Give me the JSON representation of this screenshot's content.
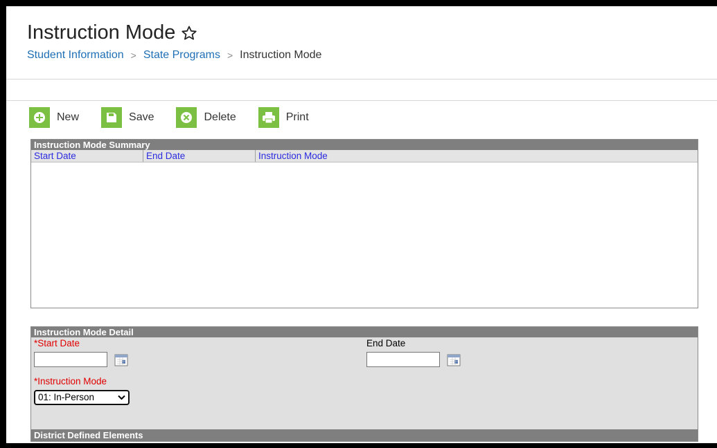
{
  "header": {
    "title": "Instruction Mode",
    "breadcrumb": {
      "items": [
        "Student Information",
        "State Programs"
      ],
      "current": "Instruction Mode",
      "separator": ">"
    }
  },
  "toolbar": {
    "new_label": "New",
    "save_label": "Save",
    "delete_label": "Delete",
    "print_label": "Print"
  },
  "summary": {
    "title": "Instruction Mode Summary",
    "columns": [
      "Start Date",
      "End Date",
      "Instruction Mode"
    ],
    "rows": []
  },
  "detail": {
    "title": "Instruction Mode Detail",
    "start_date": {
      "label": "*Start Date",
      "value": ""
    },
    "end_date": {
      "label": "End Date",
      "value": ""
    },
    "instruction_mode": {
      "label": "*Instruction Mode",
      "value": "01: In-Person"
    }
  },
  "district": {
    "title": "District Defined Elements"
  },
  "colors": {
    "accent_green": "#7bc043",
    "link_blue": "#1f6fb5",
    "header_gray": "#7f7f7f",
    "required_red": "#e00000"
  }
}
